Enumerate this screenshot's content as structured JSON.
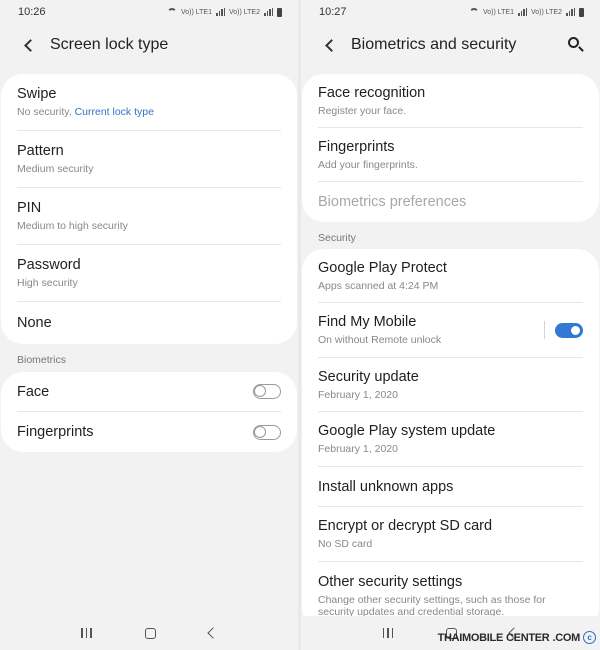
{
  "left": {
    "status": {
      "time": "10:26",
      "volte1": "Vo)) LTE1",
      "volte2": "Vo)) LTE2"
    },
    "title": "Screen lock type",
    "lock_types": [
      {
        "label": "Swipe",
        "sub": "No security,",
        "link": "Current lock type"
      },
      {
        "label": "Pattern",
        "sub": "Medium security"
      },
      {
        "label": "PIN",
        "sub": "Medium to high security"
      },
      {
        "label": "Password",
        "sub": "High security"
      },
      {
        "label": "None"
      }
    ],
    "biometrics_header": "Biometrics",
    "biometrics": [
      {
        "label": "Face",
        "enabled": false
      },
      {
        "label": "Fingerprints",
        "enabled": false
      }
    ]
  },
  "right": {
    "status": {
      "time": "10:27",
      "volte1": "Vo)) LTE1",
      "volte2": "Vo)) LTE2"
    },
    "title": "Biometrics and security",
    "biometric_items": [
      {
        "label": "Face recognition",
        "sub": "Register your face."
      },
      {
        "label": "Fingerprints",
        "sub": "Add your fingerprints."
      },
      {
        "label": "Biometrics preferences"
      }
    ],
    "security_header": "Security",
    "security_items": [
      {
        "label": "Google Play Protect",
        "sub": "Apps scanned at 4:24 PM"
      },
      {
        "label": "Find My Mobile",
        "sub": "On without Remote unlock",
        "enabled": true
      },
      {
        "label": "Security update",
        "sub": "February 1, 2020"
      },
      {
        "label": "Google Play system update",
        "sub": "February 1, 2020"
      },
      {
        "label": "Install unknown apps"
      },
      {
        "label": "Encrypt or decrypt SD card",
        "sub": "No SD card"
      },
      {
        "label": "Other security settings",
        "sub": "Change other security settings, such as those for security updates and credential storage."
      }
    ]
  },
  "watermark": {
    "brand": "THAIMOBILE",
    "brand2": "CENTER",
    "suffix": ".COM"
  },
  "colors": {
    "accent": "#3179d2",
    "link": "#3172c7",
    "background": "#f2f2f2"
  },
  "icons": {
    "back": "chevron-left-icon",
    "search": "search-icon",
    "home": "home-icon",
    "recent": "recent-apps-icon"
  }
}
